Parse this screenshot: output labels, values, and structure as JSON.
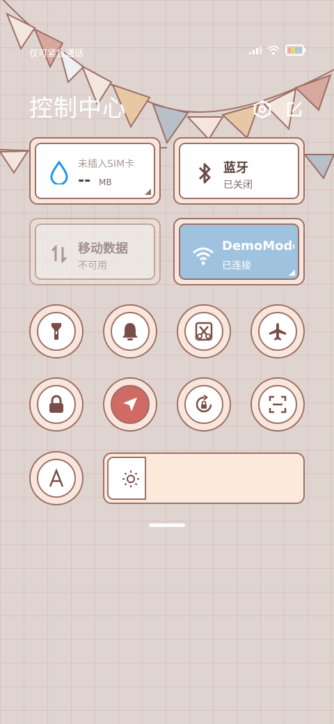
{
  "status": {
    "text": "仅可紧急通话",
    "battery_level": 0.8
  },
  "header": {
    "title": "控制中心",
    "settings_icon": "settings-hexagon-icon",
    "edit_icon": "edit-icon"
  },
  "tiles": {
    "data_usage": {
      "title": "未插入SIM卡",
      "value": "--",
      "unit": "MB",
      "icon": "water-drop-icon"
    },
    "bluetooth": {
      "title": "蓝牙",
      "status": "已关闭",
      "icon": "bluetooth-icon"
    },
    "mobile_data": {
      "title": "移动数据",
      "status": "不可用",
      "icon": "data-arrows-icon"
    },
    "wifi": {
      "title": "DemoMode",
      "status": "已连接",
      "icon": "wifi-icon"
    }
  },
  "toggles": [
    {
      "name": "flashlight",
      "icon": "flashlight-icon",
      "active": false
    },
    {
      "name": "ringer",
      "icon": "bell-icon",
      "active": false
    },
    {
      "name": "screenshot",
      "icon": "scissors-icon",
      "active": false
    },
    {
      "name": "airplane",
      "icon": "airplane-icon",
      "active": false
    },
    {
      "name": "lock",
      "icon": "lock-icon",
      "active": false
    },
    {
      "name": "location",
      "icon": "location-arrow-icon",
      "active": true
    },
    {
      "name": "rotation-lock",
      "icon": "rotation-lock-icon",
      "active": false
    },
    {
      "name": "scanner",
      "icon": "scan-icon",
      "active": false
    },
    {
      "name": "auto-brightness",
      "icon": "auto-brightness-icon",
      "active": false
    }
  ],
  "brightness": {
    "level": 0.2,
    "icon": "sun-icon"
  },
  "colors": {
    "accent_brown": "#9c6f66",
    "tile_bg": "#f8e6dc",
    "wifi_active": "#9fc3df",
    "location_active": "#cf6a64",
    "background": "#dfd4cf"
  }
}
